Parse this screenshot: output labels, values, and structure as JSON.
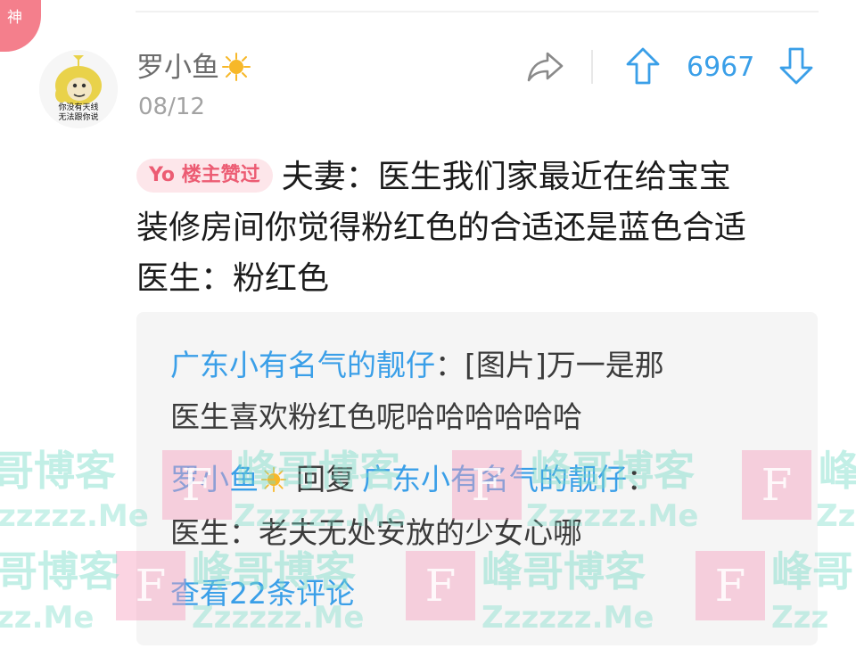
{
  "badge": {
    "label": "神"
  },
  "post": {
    "avatar_caption_1": "你没有天线",
    "avatar_caption_2": "无法跟你说",
    "username": "罗小鱼",
    "date": "08/12",
    "vote_count": "6967",
    "owner_liked_badge": "Yo 楼主赞过",
    "content_lines": [
      "夫妻：医生我们家最近在给宝宝",
      "装修房间你觉得粉红色的合适还是蓝色合适",
      "医生：粉红色"
    ]
  },
  "replies": {
    "reply1_user": "广东小有名气的靓仔",
    "reply1_sep": "：",
    "reply1_text_1": "[图片]万一是那",
    "reply1_text_2": "医生喜欢粉红色呢哈哈哈哈哈哈",
    "reply2_user": "罗小鱼",
    "reply2_action": "回复",
    "reply2_target": "广东小有名气的靓仔",
    "reply2_sep": "：",
    "reply2_text": "医生：老夫无处安放的少女心哪",
    "view_more": "查看22条评论"
  },
  "watermark": {
    "cn_a": "峰哥博客",
    "cn_b": "哥博客",
    "cn_c": "峰哥",
    "en_a": "Zzzzzz.Me",
    "en_b": "zzzzz.Me",
    "en_c": "zz.Me",
    "en_d": "Zzz",
    "letter": "F"
  },
  "colors": {
    "accent_blue": "#3a9fe8",
    "badge_pink": "#f47f8c",
    "sun_yellow": "#f7b829"
  },
  "icons": [
    "share-icon",
    "upvote-arrow-icon",
    "downvote-arrow-icon",
    "sun-icon"
  ]
}
